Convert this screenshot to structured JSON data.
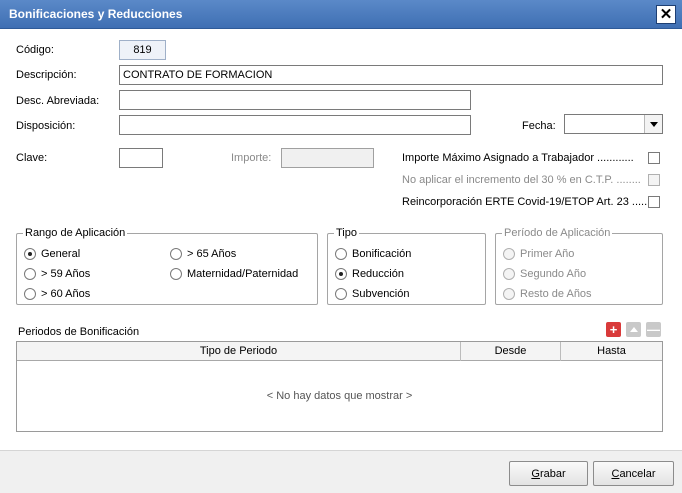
{
  "window": {
    "title": "Bonificaciones y Reducciones",
    "close": "✕"
  },
  "form": {
    "codigo": {
      "label": "Código:",
      "value": "819"
    },
    "descripcion": {
      "label": "Descripción:",
      "value": "CONTRATO DE  FORMACION"
    },
    "desc_abreviada": {
      "label": "Desc. Abreviada:",
      "value": ""
    },
    "disposicion": {
      "label": "Disposición:",
      "value": ""
    },
    "fecha": {
      "label": "Fecha:",
      "value": ""
    },
    "clave": {
      "label": "Clave:",
      "value": ""
    },
    "importe": {
      "label": "Importe:",
      "value": ""
    }
  },
  "checks": {
    "importe_maximo": "Importe Máximo Asignado a Trabajador ............",
    "no_aplicar": "No aplicar el incremento del 30 % en C.T.P. ........",
    "reincorporacion": "Reincorporación ERTE Covid-19/ETOP Art. 23 ....."
  },
  "rango": {
    "legend": "Rango de Aplicación",
    "options": [
      "General",
      "> 59 Años",
      "> 60 Años",
      "> 65 Años",
      "Maternidad/Paternidad"
    ],
    "selected": "General"
  },
  "tipo": {
    "legend": "Tipo",
    "options": [
      "Bonificación",
      "Reducción",
      "Subvención"
    ],
    "selected": "Reducción"
  },
  "periodo_aplicacion": {
    "legend": "Período de Aplicación",
    "options": [
      "Primer Año",
      "Segundo Año",
      "Resto de Años"
    ]
  },
  "periodos": {
    "title": "Periodos de Bonificación",
    "add": "+",
    "remove": "—",
    "columns": [
      "Tipo de Periodo",
      "Desde",
      "Hasta"
    ],
    "empty": "< No hay datos que mostrar >"
  },
  "footer": {
    "save_first": "G",
    "save_rest": "rabar",
    "cancel_first": "C",
    "cancel_rest": "ancelar"
  }
}
